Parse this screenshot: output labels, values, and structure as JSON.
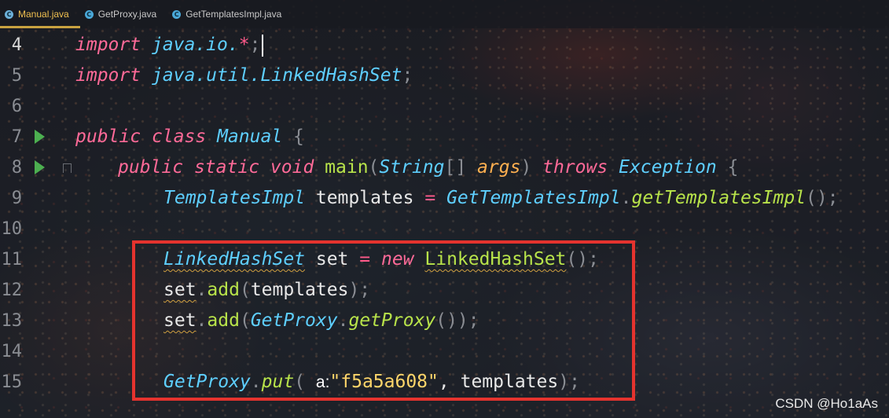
{
  "tabs": [
    {
      "label": "Manual.java",
      "icon": "java-class-icon",
      "active": true
    },
    {
      "label": "GetProxy.java",
      "icon": "java-class-icon",
      "active": false
    },
    {
      "label": "GetTemplatesImpl.java",
      "icon": "java-class-icon",
      "active": false
    }
  ],
  "tab_icon_glyph": "C",
  "line_numbers": [
    "4",
    "5",
    "6",
    "7",
    "8",
    "9",
    "10",
    "11",
    "12",
    "13",
    "14",
    "15"
  ],
  "code": {
    "l4": {
      "kw": "import",
      "pkg": " java.io.",
      "star": "*",
      "semi": ";"
    },
    "l5": {
      "kw": "import",
      "pkg": " java.util.",
      "cls": "LinkedHashSet",
      "semi": ";"
    },
    "l7": {
      "kw1": "public",
      "kw2": "class",
      "name": "Manual",
      "brace": " {"
    },
    "l8": {
      "kw1": "public",
      "kw2": "static",
      "kw3": "void",
      "fn": "main",
      "p1": "(",
      "ty": "String",
      "arr": "[] ",
      "arg": "args",
      "p2": ") ",
      "kw4": "throws",
      "ex": "Exception",
      "brace": " {"
    },
    "l9": {
      "ty": "TemplatesImpl",
      "var": " templates ",
      "eq": "=",
      "cls": "GetTemplatesImpl",
      "dot": ".",
      "fn": "getTemplatesImpl",
      "tail": "();"
    },
    "l11": {
      "ty": "LinkedHashSet",
      "var": " set ",
      "eq": "=",
      "kw": "new",
      "cls": "LinkedHashSet",
      "tail": "();"
    },
    "l12": {
      "obj": "set",
      "dot": ".",
      "fn": "add",
      "p1": "(",
      "arg": "templates",
      "tail": ");"
    },
    "l13": {
      "obj": "set",
      "dot": ".",
      "fn": "add",
      "p1": "(",
      "cls": "GetProxy",
      "dot2": ".",
      "fn2": "getProxy",
      "tail": "());"
    },
    "l15": {
      "cls": "GetProxy",
      "dot": ".",
      "fn": "put",
      "p1": "( ",
      "hint": "a:",
      "str": "\"f5a5a608\"",
      "comma": ", ",
      "arg": "templates",
      "tail": ");"
    }
  },
  "watermark": "CSDN @Ho1aAs",
  "colors": {
    "keyword": "#ff6a98",
    "type": "#5ecfff",
    "function": "#b8e34a",
    "string": "#ffd66a",
    "highlight_box": "#e5332e",
    "run_icon": "#4caf50"
  }
}
